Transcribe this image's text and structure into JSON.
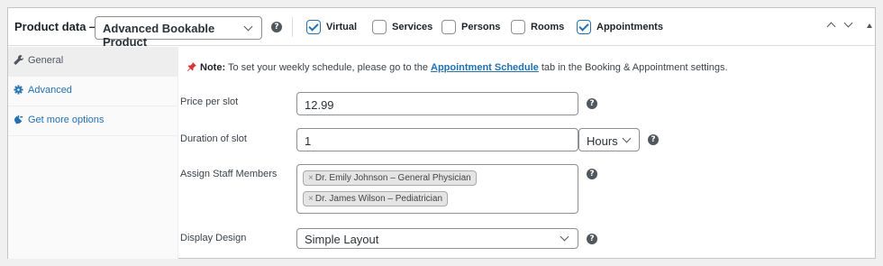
{
  "header": {
    "title": "Product data —",
    "product_type": "Advanced Bookable Product",
    "options": [
      {
        "label": "Virtual",
        "checked": true
      },
      {
        "label": "Services",
        "checked": false
      },
      {
        "label": "Persons",
        "checked": false
      },
      {
        "label": "Rooms",
        "checked": false
      },
      {
        "label": "Appointments",
        "checked": true
      }
    ]
  },
  "sidebar": {
    "items": [
      {
        "label": "General",
        "icon": "wrench-icon",
        "active": true
      },
      {
        "label": "Advanced",
        "icon": "gear-icon",
        "active": false
      },
      {
        "label": "Get more options",
        "icon": "plug-icon",
        "active": false
      }
    ]
  },
  "note": {
    "prefix": "Note:",
    "text_before": " To set your weekly schedule, please go to the ",
    "link": "Appointment Schedule",
    "text_after": " tab in the Booking & Appointment settings."
  },
  "fields": {
    "price_label": "Price per slot",
    "price_value": "12.99",
    "duration_label": "Duration of slot",
    "duration_value": "1",
    "duration_unit": "Hours",
    "staff_label": "Assign Staff Members",
    "staff": [
      "Dr. Emily Johnson – General Physician",
      "Dr. James Wilson – Pediatrician"
    ],
    "design_label": "Display Design",
    "design_value": "Simple Layout"
  },
  "colors": {
    "accent": "#2271b1",
    "pin": "#d63638"
  }
}
